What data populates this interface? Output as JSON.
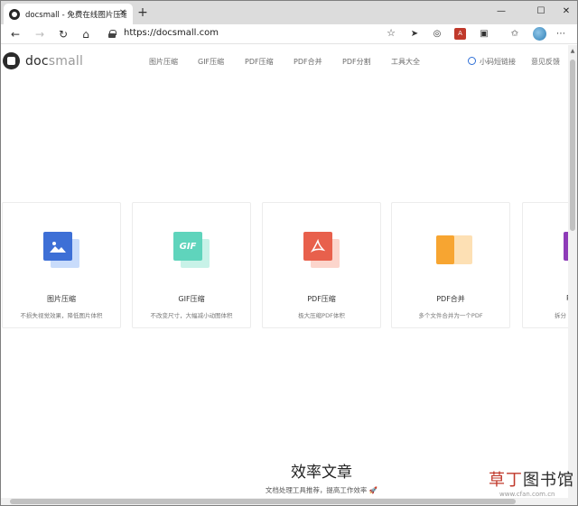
{
  "browser": {
    "tab_title": "docsmall - 免费在线图片压缩、G",
    "tab_close": "✕",
    "new_tab": "+",
    "url": "https://docsmall.com",
    "window_controls": {
      "minimize": "—",
      "maximize": "☐",
      "close": "✕"
    },
    "icons": [
      "back-arrow-icon",
      "forward-arrow-icon",
      "refresh-icon",
      "home-icon",
      "lock-icon",
      "star-icon",
      "favorites-icon",
      "more-icon"
    ]
  },
  "site": {
    "logo_doc": "doc",
    "logo_small": "small",
    "nav": [
      "图片压缩",
      "GIF压缩",
      "PDF压缩",
      "PDF合并",
      "PDF分割",
      "工具大全"
    ],
    "short_link": "小码短链接",
    "feedback": "意见反馈"
  },
  "cards": [
    {
      "title": "图片压缩",
      "desc": "不损失视觉效果，降低图片体积",
      "icon": "image-icon",
      "color": "#3d6fd6",
      "back_color": "#c9dcfb"
    },
    {
      "title": "GIF压缩",
      "desc": "不改变尺寸，大幅减小动图体积",
      "icon": "gif-icon",
      "label": "GIF",
      "color": "#5fd4bc",
      "back_color": "#c8f2e8"
    },
    {
      "title": "PDF压缩",
      "desc": "极大压缩PDF体积",
      "icon": "pdf-icon",
      "color": "#e8604c",
      "back_color": "#fcd5cc"
    },
    {
      "title": "PDF合并",
      "desc": "多个文件合并为一个PDF",
      "icon": "puzzle-icon",
      "color": "#f7a531",
      "back_color": "#fde0b4"
    },
    {
      "title": "P",
      "desc": "拆分",
      "icon": "split-icon",
      "color": "#8e3bb8",
      "back_color": "#e3cdf0"
    }
  ],
  "section": {
    "title": "效率文章",
    "subtitle": "文档处理工具推荐，提高工作效率 🚀"
  },
  "watermark": {
    "main_red": "草丁",
    "main_dark": "图书馆",
    "sub": "www.cfan.com.cn"
  }
}
